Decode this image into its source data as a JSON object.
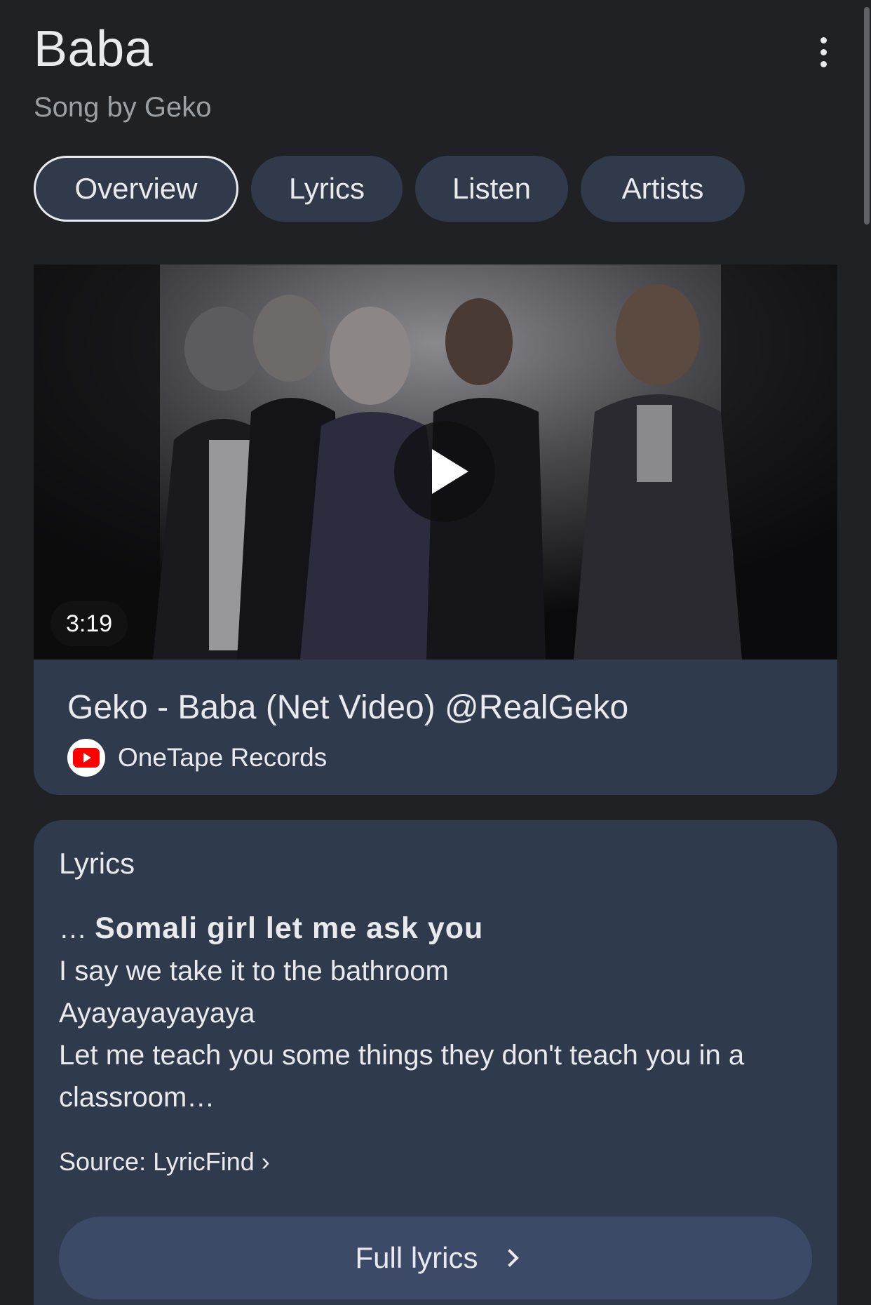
{
  "header": {
    "title": "Baba",
    "subtitle": "Song by Geko",
    "more_icon": "more-vert-icon"
  },
  "tabs": [
    {
      "label": "Overview",
      "active": true
    },
    {
      "label": "Lyrics",
      "active": false
    },
    {
      "label": "Listen",
      "active": false
    },
    {
      "label": "Artists",
      "active": false
    }
  ],
  "video": {
    "duration": "3:19",
    "title": "Geko - Baba (Net Video) @RealGeko",
    "channel": "OneTape Records",
    "channel_icon": "youtube-icon",
    "play_icon": "play-icon"
  },
  "lyrics": {
    "heading": "Lyrics",
    "prefix": "… ",
    "highlight": "Somali girl let me ask you",
    "lines": [
      "I say we take it to the bathroom",
      "Ayayayayayaya",
      "Let me teach you some things they don't teach you in a",
      "classroom…"
    ],
    "source": "Source: LyricFind ›",
    "button_label": "Full lyrics"
  },
  "colors": {
    "background": "#202124",
    "card": "#303a4d",
    "tab": "#303a4b",
    "button": "#3c4a68",
    "youtube_red": "#ff0000"
  }
}
